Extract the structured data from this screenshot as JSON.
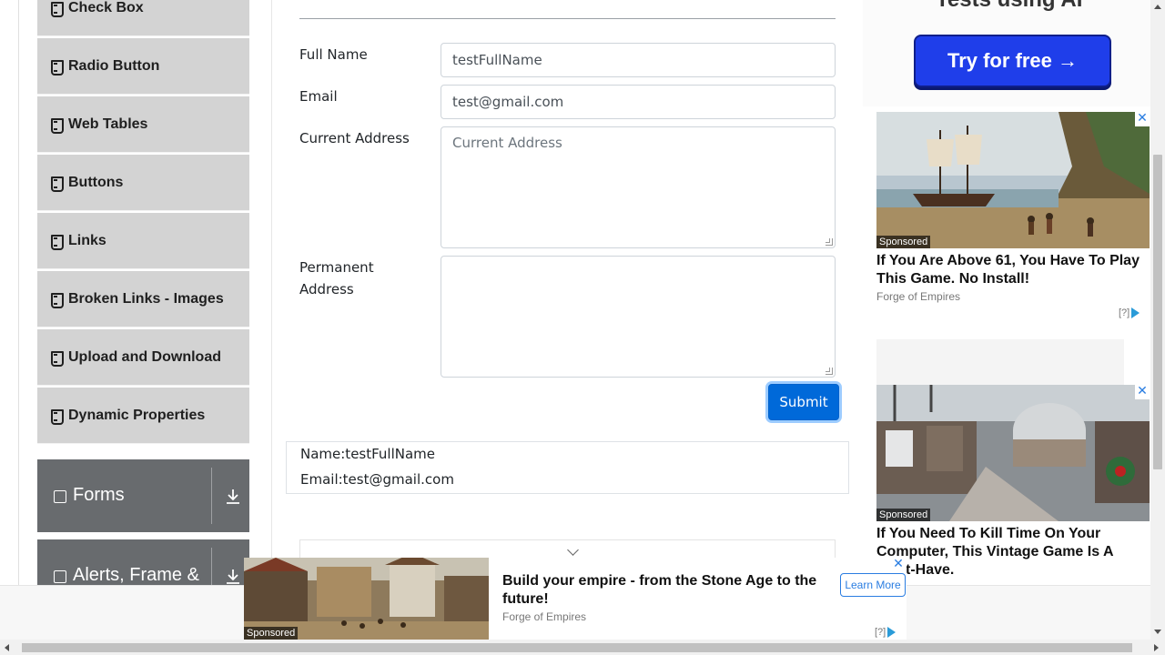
{
  "sidebar": {
    "items": [
      {
        "label": "Check Box"
      },
      {
        "label": "Radio Button"
      },
      {
        "label": "Web Tables"
      },
      {
        "label": "Buttons"
      },
      {
        "label": "Links"
      },
      {
        "label": "Broken Links - Images"
      },
      {
        "label": "Upload and Download"
      },
      {
        "label": "Dynamic Properties"
      }
    ],
    "groups": [
      {
        "label": "Forms",
        "icon": "form-icon"
      },
      {
        "label": "Alerts, Frame & Windows",
        "icon": "window-icon"
      }
    ]
  },
  "form": {
    "full_name_label": "Full Name",
    "full_name_value": "testFullName",
    "email_label": "Email",
    "email_value": "test@gmail.com",
    "current_address_label": "Current Address",
    "current_address_placeholder": "Current Address",
    "permanent_address_label": "Permanent Address",
    "submit_label": "Submit"
  },
  "output": {
    "name": "Name:testFullName",
    "email": "Email:test@gmail.com"
  },
  "ads": {
    "top_tagline": "Tests using AI",
    "try_button": "Try for free →",
    "sponsored": "Sponsored",
    "ad1_title": "If You Are Above 61, You Have To Play This Game. No Install!",
    "ad1_source": "Forge of Empires",
    "ad2_title": "If You Need To Kill Time On Your Computer, This Vintage Game Is A Must-Have.",
    "ad2_source": "Forge of Empires",
    "adchoices": "[?]",
    "close": "✕",
    "banner_title": "Build your empire - from the Stone Age to the future!",
    "banner_source": "Forge of Empires",
    "banner_button": "Learn More"
  },
  "colors": {
    "menu_bg": "#d3d3d3",
    "group_bg": "#686b6e",
    "primary": "#0069d9",
    "try_button": "#1f3eea"
  }
}
